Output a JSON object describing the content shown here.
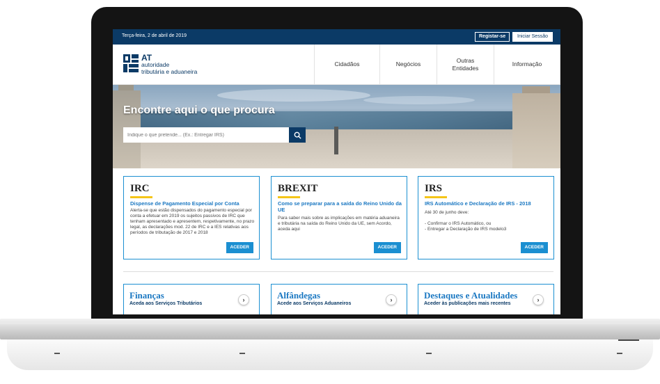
{
  "topbar": {
    "date": "Terça-feira, 2 de abril de 2019",
    "register": "Registar-se",
    "login": "Iniciar Sessão"
  },
  "logo": {
    "abbr": "AT",
    "line1": "autoridade",
    "line2": "tributária e aduaneira"
  },
  "nav": {
    "items": [
      "Cidadãos",
      "Negócios",
      "Outras Entidades",
      "Informação"
    ]
  },
  "hero": {
    "title": "Encontre aqui o que procura",
    "search_placeholder": "Indique o que pretende... (Ex.: Entregar IRS)"
  },
  "cards": [
    {
      "title": "IRC",
      "subtitle": "Dispense de Pagamento Especial por Conta",
      "text": "Alerta-se que estão dispensados do pagamento especial por conta a efetuar em 2019 os sujeitos passivos de IRC que tenham apresentado e apresentem, respetivamente, no prazo legal, as declarações mod. 22 de IRC e a IES relativas aos períodos de tributação de 2017 e 2018",
      "button": "ACEDER"
    },
    {
      "title": "BREXIT",
      "subtitle": "Como se preparar para a saída do Reino Unido da UE",
      "text": "Para saber mais sobre as implicações em matéria aduaneira e tributária na saída do Reino Unido da UE, sem Acordo, aceda aqui",
      "button": "ACEDER"
    },
    {
      "title": "IRS",
      "subtitle": "IRS Automático e Declaração de IRS - 2018",
      "text_lines": [
        "Até 30 de junho deve:",
        "- Confirmar o IRS Automático, ou",
        "- Entregar a Declaração de IRS modelo3"
      ],
      "button": "ACEDER"
    }
  ],
  "tiles": [
    {
      "title": "Finanças",
      "subtitle": "Aceda aos Serviços Tributários"
    },
    {
      "title": "Alfândegas",
      "subtitle": "Acede aos Serviços Aduaneiros"
    },
    {
      "title": "Destaques e Atualidades",
      "subtitle": "Aceder às publicações mais recentes"
    }
  ],
  "colors": {
    "brand_navy": "#0b3a66",
    "accent_blue": "#1b8fd1",
    "highlight_yellow": "#f5c518"
  },
  "icons": {
    "search": "search-icon",
    "arrow": "chevron-right-icon",
    "logo": "at-logo-icon"
  }
}
